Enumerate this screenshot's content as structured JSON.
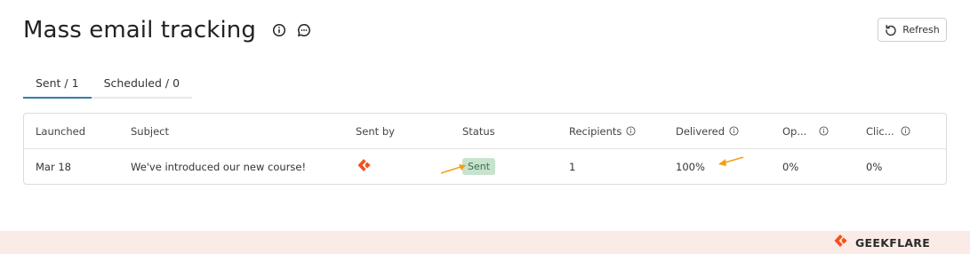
{
  "header": {
    "title": "Mass email tracking",
    "icons": [
      "info-circle-icon",
      "chat-bubble-icon"
    ]
  },
  "toolbar": {
    "refresh_label": "Refresh",
    "refresh_icon": "refresh-icon"
  },
  "tabs": [
    {
      "label": "Sent / 1",
      "active": true
    },
    {
      "label": "Scheduled / 0",
      "active": false
    }
  ],
  "table": {
    "columns": [
      "Launched",
      "Subject",
      "Sent by",
      "Status",
      "Recipients",
      "Delivered",
      "Op...",
      "Clic..."
    ],
    "columns_with_info_icon": [
      "Recipients",
      "Delivered",
      "Op...",
      "Clic..."
    ],
    "rows": [
      {
        "launched": "Mar 18",
        "subject": "We've introduced our new course!",
        "sent_by_icon": "geekflare-logo-icon",
        "status": "Sent",
        "recipients": "1",
        "delivered": "100%",
        "opened": "0%",
        "clicked": "0%"
      }
    ]
  },
  "annotations": [
    "arrow-pointing-status",
    "arrow-pointing-delivered"
  ],
  "footer": {
    "brand": "GEEKFLARE"
  },
  "colors": {
    "accent": "#2f7fa8",
    "status_sent_bg": "#c7e3cf",
    "status_sent_text": "#3a6d47",
    "annotation_arrow": "#f2a014",
    "brand_orange": "#f4511e",
    "footer_bg": "#fbebe6"
  }
}
